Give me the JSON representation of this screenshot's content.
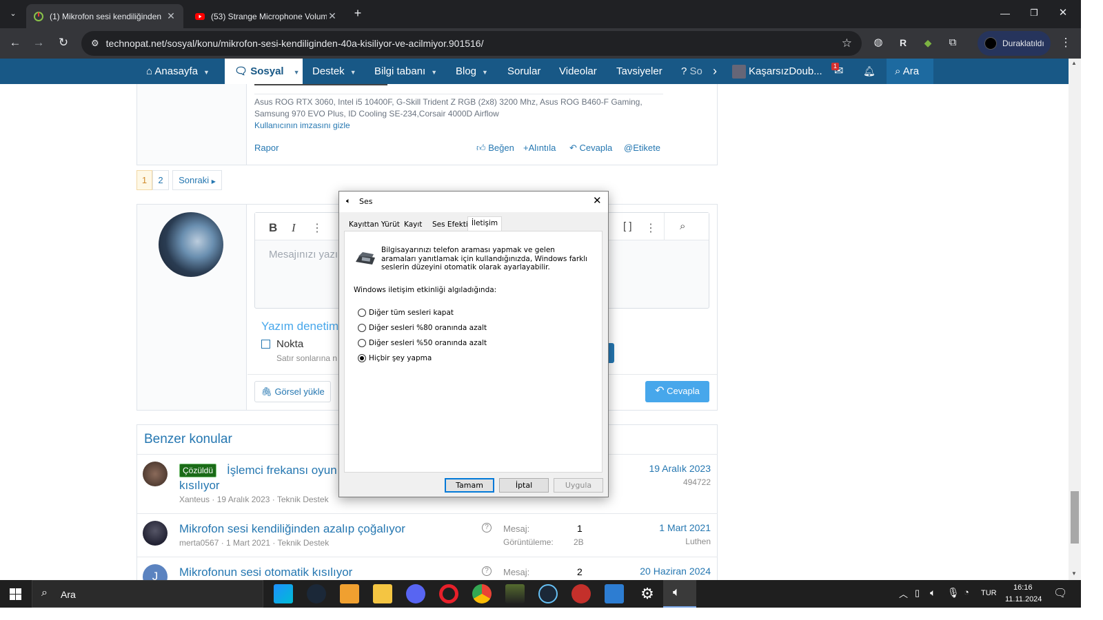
{
  "browser": {
    "tabs": [
      {
        "title": "(1) Mikrofon sesi kendiliğinden"
      },
      {
        "title": "(53) Strange Microphone Volum"
      }
    ],
    "url": "technopat.net/sosyal/konu/mikrofon-sesi-kendiliginden-40a-kisiliyor-ve-acilmiyor.901516/",
    "profile_label": "Duraklatıldı",
    "new_tab_label": "+"
  },
  "site_nav": {
    "items": [
      {
        "label": "Anasayfa"
      },
      {
        "label": "Sosyal"
      },
      {
        "label": "Destek"
      },
      {
        "label": "Bilgi tabanı"
      },
      {
        "label": "Blog"
      },
      {
        "label": "Sorular"
      },
      {
        "label": "Videolar"
      },
      {
        "label": "Tavsiyeler"
      },
      {
        "label": "So"
      }
    ],
    "username": "KaşarsızDoub...",
    "inbox_badge": "1",
    "search_label": "Ara"
  },
  "post": {
    "signature": "Asus ROG RTX 3060, Intel i5 10400F, G-Skill Trident Z RGB (2x8) 3200 Mhz, Asus ROG B460-F Gaming, Samsung 970 EVO Plus, ID Cooling SE-234,Corsair 4000D Airflow",
    "hide_signature": "Kullanıcının imzasını gizle",
    "report": "Rapor",
    "actions": [
      "Beğen",
      "Alıntıla",
      "Cevapla",
      "Etikete"
    ]
  },
  "pagination": {
    "pages": [
      "1",
      "2"
    ],
    "next": "Sonraki"
  },
  "reply": {
    "placeholder": "Mesajınızı yazın",
    "spellcheck": "Yazım denetimi",
    "option": "Nokta",
    "hint": "Satır sonlarına n",
    "upload": "Görsel yükle",
    "submit": "Cevapla"
  },
  "similar": {
    "heading": "Benzer konular",
    "threads": [
      {
        "badge": "Çözüldü",
        "title": "İşlemci frekansı oyun i",
        "title2": "kısılıyor",
        "meta": "Xanteus · 19 Aralık 2023 · Teknik Destek",
        "date": "19 Aralık 2023",
        "sub": "494722"
      },
      {
        "title": "Mikrofon sesi kendiliğinden azalıp çoğalıyor",
        "meta": "merta0567 · 1 Mart 2021 · Teknik Destek",
        "msg_label": "Mesaj:",
        "msg": "1",
        "views_label": "Görüntüleme:",
        "views": "2B",
        "date": "1 Mart 2021",
        "last": "Luthen"
      },
      {
        "title": "Mikrofonun sesi otomatik kısılıyor",
        "avatar": "J",
        "msg_label": "Mesaj:",
        "msg": "2",
        "date": "20 Haziran 2024"
      }
    ]
  },
  "dialog": {
    "title": "Ses",
    "tabs": [
      "Kayıttan Yürüt",
      "Kayıt",
      "Ses Efekti",
      "İletişim"
    ],
    "description": "Bilgisayarınızı telefon araması yapmak ve gelen aramaları yanıtlamak için kullandığınızda, Windows farklı seslerin düzeyini otomatik olarak ayarlayabilir.",
    "prompt": "Windows iletişim etkinliği algıladığında:",
    "options": [
      "Diğer tüm sesleri kapat",
      "Diğer sesleri %80 oranında azalt",
      "Diğer sesleri %50 oranında azalt",
      "Hiçbir şey yapma"
    ],
    "selected_index": 3,
    "buttons": {
      "ok": "Tamam",
      "cancel": "İptal",
      "apply": "Uygula"
    }
  },
  "taskbar": {
    "search_label": "Ara",
    "language": "TUR",
    "time": "16:16",
    "date": "11.11.2024"
  }
}
